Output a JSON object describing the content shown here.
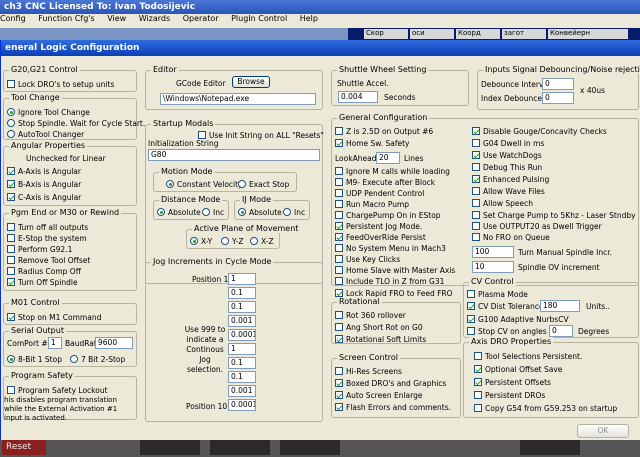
{
  "app_title": "ch3 CNC  Licensed To: Ivan Todosijevic",
  "menu": [
    "Config",
    "Function Cfg's",
    "View",
    "Wizards",
    "Operator",
    "PlugIn Control",
    "Help"
  ],
  "bg_strip": [
    "Скор",
    "оси",
    "Коорд",
    "загот",
    "Конвейерн"
  ],
  "bg_bottom": [
    "Reset",
    "",
    "",
    "",
    ""
  ],
  "dialog": {
    "title": "eneral Logic Configuration",
    "g20": {
      "title": "G20,G21 Control",
      "lock": "Lock DRO's to setup units",
      "lock_on": false
    },
    "tool_change": {
      "title": "Tool Change",
      "options": [
        "Ignore Tool Change",
        "Stop Spindle. Wait for Cycle Start.",
        "AutoTool Changer"
      ],
      "selected": 0
    },
    "angular": {
      "title": "Angular Properties",
      "subtitle": "Unchecked for Linear",
      "items": [
        {
          "label": "A-Axis is Angular",
          "on": true
        },
        {
          "label": "B-Axis is Angular",
          "on": true
        },
        {
          "label": "C-Axis is Angular",
          "on": true
        }
      ]
    },
    "pgm_end": {
      "title": "Pgm End or M30 or Rewind",
      "items": [
        {
          "label": "Turn off all outputs",
          "on": false
        },
        {
          "label": "E-Stop the system",
          "on": false
        },
        {
          "label": "Perform G92.1",
          "on": false
        },
        {
          "label": "Remove Tool Offset",
          "on": false
        },
        {
          "label": "Radius Comp Off",
          "on": false
        },
        {
          "label": "Turn Off Spindle",
          "on": true
        }
      ]
    },
    "m01": {
      "title": "M01 Control",
      "label": "Stop on M1 Command",
      "on": true
    },
    "serial": {
      "title": "Serial Output",
      "comport_label": "ComPort #",
      "comport": "1",
      "baud_label": "BaudRate",
      "baud": "9600",
      "bits": [
        "8-Bit 1 Stop",
        "7 Bit 2-Stop"
      ],
      "bits_selected": 0
    },
    "safety": {
      "title": "Program Safety",
      "label": "Program Safety Lockout",
      "on": false,
      "note": "his disables program translation while the External Activation #1 input is activated."
    },
    "editor": {
      "title": "Editor",
      "label": "GCode Editor",
      "browse": "Browse",
      "path": "\\Windows\\Notepad.exe"
    },
    "startup": {
      "title": "Startup Modals",
      "use_init_label": "Use Init String on ALL  \"Resets\"",
      "use_init_on": false,
      "init_label": "Initialization String",
      "init_value": "G80"
    },
    "motion": {
      "title": "Motion Mode",
      "options": [
        "Constant Velocity",
        "Exact Stop"
      ],
      "selected": 0
    },
    "distance": {
      "title": "Distance Mode",
      "options": [
        "Absolute",
        "Inc"
      ],
      "selected": 0
    },
    "ij": {
      "title": "IJ Mode",
      "options": [
        "Absolute",
        "Inc"
      ],
      "selected": 0
    },
    "plane": {
      "title": "Active Plane of Movement",
      "options": [
        "X-Y",
        "Y-Z",
        "X-Z"
      ],
      "selected": 0
    },
    "jog": {
      "title": "Jog Increments in Cycle Mode",
      "pos1": "Position 1",
      "pos10": "Position 10",
      "note": "Use 999 to indicate a Continous Jog selection.",
      "values": [
        "1",
        "0.1",
        "0.1",
        "0.001",
        "0.0001",
        "1",
        "0.1",
        "0.1",
        "0.001",
        "0.0001"
      ]
    },
    "shuttle": {
      "title": "Shuttle Wheel Setting",
      "label": "Shuttle Accel.",
      "value": "0.004",
      "unit": "Seconds"
    },
    "debounce": {
      "title": "Inputs Signal Debouncing/Noise rejection",
      "interval_label": "Debounce Interval",
      "interval": "0",
      "index_label": "Index Debounce",
      "index": "0",
      "unit": "x 40us"
    },
    "general": {
      "title": "General Configuration",
      "left": [
        {
          "label": "Z is 2.5D on Output #6",
          "on": false
        },
        {
          "label": "Home Sw. Safety",
          "on": true
        }
      ],
      "lookahead_label": "LookAhead",
      "lookahead": "20",
      "lookahead_unit": "Lines",
      "left2": [
        {
          "label": "Ignore M calls while loading",
          "on": false
        },
        {
          "label": "M9- Execute after Block",
          "on": false
        },
        {
          "label": "UDP Pendent Control",
          "on": false
        },
        {
          "label": "Run Macro Pump",
          "on": false
        },
        {
          "label": "ChargePump On in EStop",
          "on": false
        },
        {
          "label": "Persistent Jog Mode.",
          "on": true
        },
        {
          "label": "FeedOverRide Persist",
          "on": true
        },
        {
          "label": "No System Menu in Mach3",
          "on": false
        },
        {
          "label": "Use Key Clicks",
          "on": false
        },
        {
          "label": "Home Slave with Master Axis",
          "on": false
        },
        {
          "label": "Include TLO in Z from G31",
          "on": false
        },
        {
          "label": "Lock Rapid FRO to Feed FRO",
          "on": true
        }
      ],
      "right": [
        {
          "label": "Disable Gouge/Concavity Checks",
          "on": true
        },
        {
          "label": "G04 Dwell in ms",
          "on": false
        },
        {
          "label": "Use WatchDogs",
          "on": true
        },
        {
          "label": "Debug This Run",
          "on": false
        },
        {
          "label": "Enhanced Pulsing",
          "on": true
        },
        {
          "label": "Allow Wave Files",
          "on": false
        },
        {
          "label": "Allow Speech",
          "on": false
        },
        {
          "label": "Set Charge Pump to 5Khz  - Laser Stndby",
          "on": false
        },
        {
          "label": "Use OUTPUT20 as Dwell Trigger",
          "on": false
        },
        {
          "label": "No FRO on Queue",
          "on": false
        }
      ],
      "manual_val": "100",
      "manual_label": "Turn Manual Spindle Incr.",
      "ov_val": "10",
      "ov_label": "Spindle OV increment"
    },
    "rotational": {
      "title": "Rotational",
      "items": [
        {
          "label": "Rot 360 rollover",
          "on": false
        },
        {
          "label": "Ang Short Rot on G0",
          "on": false
        },
        {
          "label": "Rotational Soft Limits",
          "on": true
        }
      ]
    },
    "cv": {
      "title": "CV Control",
      "plasma_label": "Plasma Mode",
      "plasma_on": false,
      "dist_label": "CV Dist Tolerance",
      "dist_on": true,
      "dist_val": "180",
      "dist_unit": "Units..",
      "nurbs_label": "G100 Adaptive NurbsCV",
      "nurbs_on": true,
      "stop_label": "Stop CV on angles >",
      "stop_on": false,
      "stop_val": "0",
      "stop_unit": "Degrees"
    },
    "screen": {
      "title": "Screen Control",
      "items": [
        {
          "label": "Hi-Res Screens",
          "on": false
        },
        {
          "label": "Boxed DRO's and Graphics",
          "on": true
        },
        {
          "label": "Auto Screen Enlarge",
          "on": true
        },
        {
          "label": "Flash Errors and comments.",
          "on": true
        }
      ]
    },
    "axis_dro": {
      "title": "Axis DRO Properties",
      "items": [
        {
          "label": "Tool Selections Persistent.",
          "on": false
        },
        {
          "label": "Optional Offset Save",
          "on": true
        },
        {
          "label": "Persistent Offsets",
          "on": true
        },
        {
          "label": "Persistent DROs",
          "on": false
        },
        {
          "label": "Copy G54 from G59.253 on startup",
          "on": false
        }
      ]
    },
    "ok": "OK"
  }
}
